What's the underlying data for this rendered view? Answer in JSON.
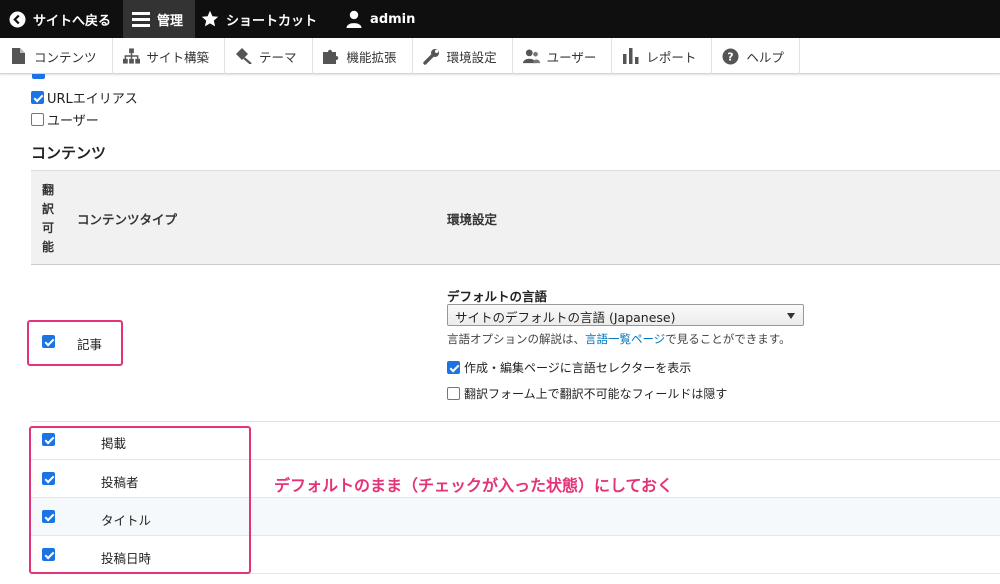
{
  "toolbar": {
    "back_label": "サイトへ戻る",
    "manage_label": "管理",
    "shortcuts_label": "ショートカット",
    "user_label": "admin"
  },
  "menu": {
    "items": [
      {
        "label": "コンテンツ",
        "icon": "file-icon"
      },
      {
        "label": "サイト構築",
        "icon": "sitemap-icon"
      },
      {
        "label": "テーマ",
        "icon": "paint-icon"
      },
      {
        "label": "機能拡張",
        "icon": "puzzle-icon"
      },
      {
        "label": "環境設定",
        "icon": "wrench-icon"
      },
      {
        "label": "ユーザー",
        "icon": "people-icon"
      },
      {
        "label": "レポート",
        "icon": "bar-chart-icon"
      },
      {
        "label": "ヘルプ",
        "icon": "help-icon"
      }
    ]
  },
  "entity_list": {
    "url_alias_label": "URLエイリアス",
    "user_label": "ユーザー"
  },
  "content_section": {
    "title": "コンテンツ",
    "header": {
      "translatable": "翻訳可能",
      "type": "コンテンツタイプ",
      "settings": "環境設定"
    },
    "article": {
      "label": "記事",
      "default_lang_label": "デフォルトの言語",
      "default_lang_value": "サイトのデフォルトの言語 (Japanese)",
      "desc_prefix": "言語オプションの解説は、",
      "desc_link": "言語一覧ページ",
      "desc_suffix": "で見ることができます。",
      "show_selector_label": "作成・編集ページに言語セレクターを表示",
      "hide_untranslatable_label": "翻訳フォーム上で翻訳不可能なフィールドは隠す"
    },
    "fields": [
      "掲載",
      "投稿者",
      "タイトル",
      "投稿日時"
    ]
  },
  "annotation": "デフォルトのまま（チェックが入った状態）にしておく",
  "colors": {
    "accent": "#e5337a",
    "checkbox": "#1b74e4",
    "link": "#0074bd"
  }
}
